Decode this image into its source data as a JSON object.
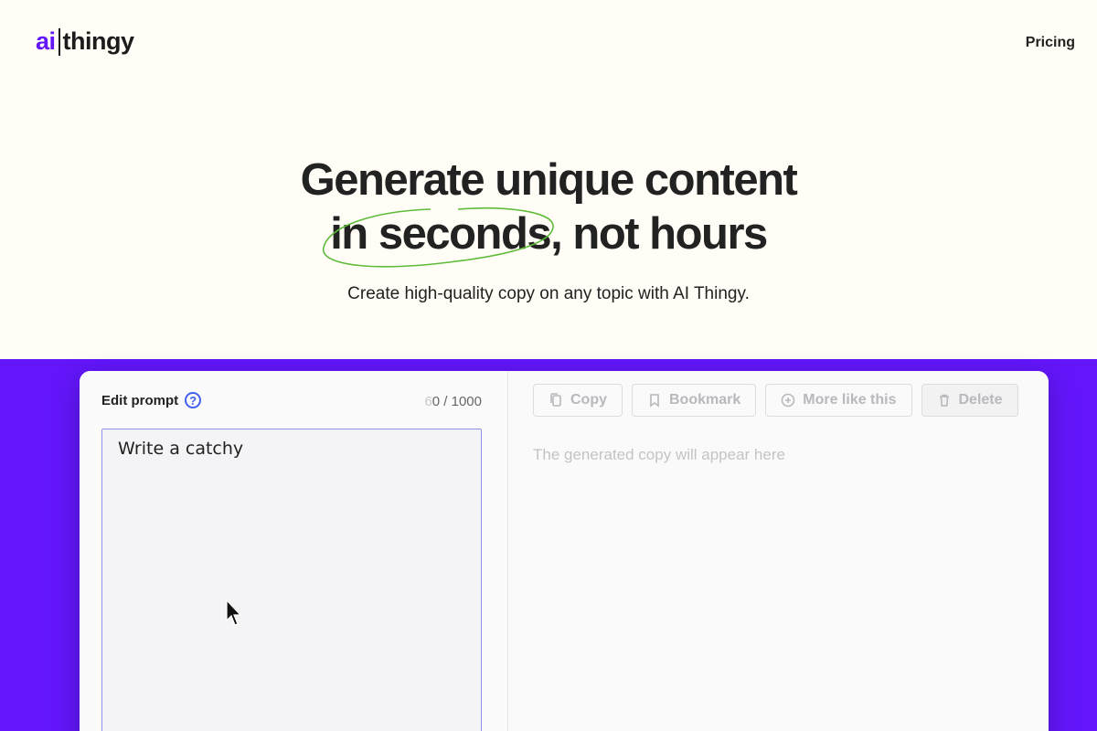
{
  "header": {
    "logo_ai": "ai",
    "logo_rest": "thingy",
    "nav_pricing": "Pricing"
  },
  "hero": {
    "headline_line1": "Generate unique content",
    "headline_highlight": "in seconds",
    "headline_rest": ", not hours",
    "subtitle": "Create high-quality copy on any topic with AI Thingy.",
    "highlight_color": "#5dbb37"
  },
  "editor": {
    "label": "Edit prompt",
    "help_glyph": "?",
    "counter_ghost": "6",
    "counter_value": "0 / 1000",
    "prompt_value": "Write a catchy"
  },
  "output": {
    "buttons": {
      "copy": "Copy",
      "bookmark": "Bookmark",
      "more": "More like this",
      "delete": "Delete"
    },
    "placeholder": "The generated copy will appear here"
  },
  "colors": {
    "brand": "#6316fb",
    "background": "#fffdf5",
    "help_icon": "#4361ee"
  }
}
